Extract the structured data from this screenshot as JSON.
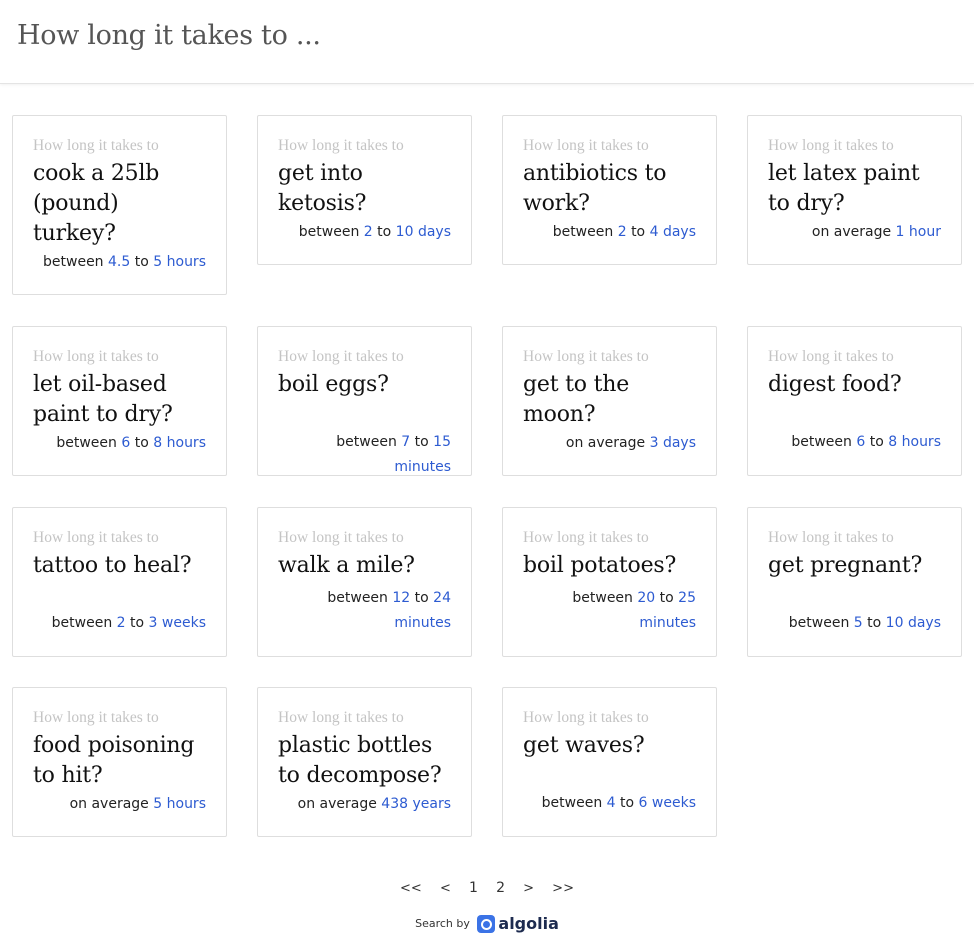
{
  "search": {
    "query": "How long it takes to ..."
  },
  "card_prefix": "How long it takes to",
  "cards": [
    {
      "question": "cook a 25lb (pound) turkey?",
      "qualifier": "between",
      "from": "4.5",
      "connector": "to",
      "to": "5",
      "unit": "hours"
    },
    {
      "question": "get into ketosis?",
      "qualifier": "between",
      "from": "2",
      "connector": "to",
      "to": "10",
      "unit": "days"
    },
    {
      "question": "antibiotics to work?",
      "qualifier": "between",
      "from": "2",
      "connector": "to",
      "to": "4",
      "unit": "days"
    },
    {
      "question": "let latex paint to dry?",
      "qualifier": "on average",
      "from": "",
      "connector": "",
      "to": "1",
      "unit": "hour"
    },
    {
      "question": "let oil-based paint to dry?",
      "qualifier": "between",
      "from": "6",
      "connector": "to",
      "to": "8",
      "unit": "hours"
    },
    {
      "question": "boil eggs?",
      "qualifier": "between",
      "from": "7",
      "connector": "to",
      "to": "15",
      "unit": "minutes"
    },
    {
      "question": "get to the moon?",
      "qualifier": "on average",
      "from": "",
      "connector": "",
      "to": "3",
      "unit": "days"
    },
    {
      "question": "digest food?",
      "qualifier": "between",
      "from": "6",
      "connector": "to",
      "to": "8",
      "unit": "hours"
    },
    {
      "question": "tattoo to heal?",
      "qualifier": "between",
      "from": "2",
      "connector": "to",
      "to": "3",
      "unit": "weeks"
    },
    {
      "question": "walk a mile?",
      "qualifier": "between",
      "from": "12",
      "connector": "to",
      "to": "24",
      "unit": "minutes"
    },
    {
      "question": "boil potatoes?",
      "qualifier": "between",
      "from": "20",
      "connector": "to",
      "to": "25",
      "unit": "minutes"
    },
    {
      "question": "get pregnant?",
      "qualifier": "between",
      "from": "5",
      "connector": "to",
      "to": "10",
      "unit": "days"
    },
    {
      "question": "food poisoning to hit?",
      "qualifier": "on average",
      "from": "",
      "connector": "",
      "to": "5",
      "unit": "hours"
    },
    {
      "question": "plastic bottles to decompose?",
      "qualifier": "on average",
      "from": "",
      "connector": "",
      "to": "438",
      "unit": "years"
    },
    {
      "question": "get waves?",
      "qualifier": "between",
      "from": "4",
      "connector": "to",
      "to": "6",
      "unit": "weeks"
    }
  ],
  "pagination": {
    "first": "<<",
    "prev": "<",
    "pages": [
      "1",
      "2"
    ],
    "next": ">",
    "last": ">>"
  },
  "powered_by": {
    "label": "Search by",
    "brand": "algolia"
  },
  "colors": {
    "accent": "#2d5bd1",
    "prefix": "#c4c4c4",
    "border": "#dedede"
  }
}
